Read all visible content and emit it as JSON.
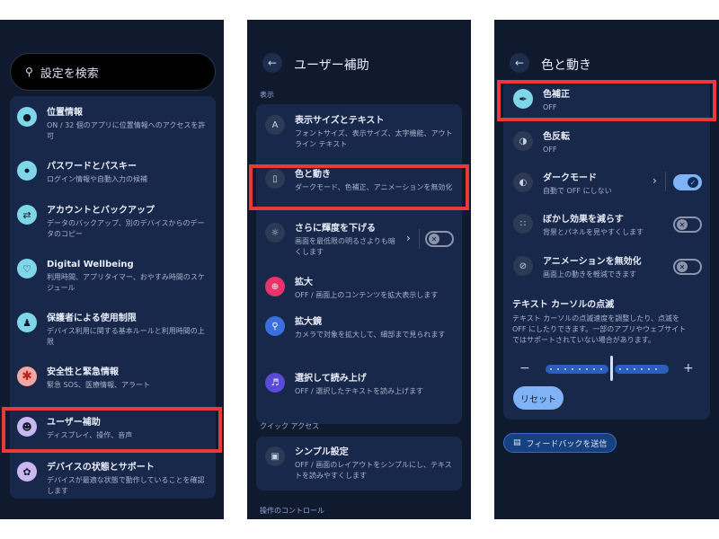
{
  "panel1": {
    "search_placeholder": "設定を検索",
    "items": [
      {
        "title": "位置情報",
        "sub": "ON / 32 個のアプリに位置情報へのアクセスを許可",
        "icon": "location-pin-icon",
        "color": "#7fd6e8"
      },
      {
        "title": "パスワードとパスキー",
        "sub": "ログイン情報や自動入力の候補",
        "icon": "key-icon",
        "color": "#7fd6e8"
      },
      {
        "title": "アカウントとバックアップ",
        "sub": "データのバックアップ、別のデバイスからのデータのコピー",
        "icon": "sync-icon",
        "color": "#7fd6e8"
      },
      {
        "title": "Digital Wellbeing",
        "sub": "利用時間、アプリタイマー、おやすみ時間のスケジュール",
        "icon": "wellbeing-icon",
        "color": "#7fd6e8"
      },
      {
        "title": "保護者による使用制限",
        "sub": "デバイス利用に関する基本ルールと利用時間の上限",
        "icon": "parental-icon",
        "color": "#7fd6e8"
      },
      {
        "title": "安全性と緊急情報",
        "sub": "緊急 SOS、医療情報、アラート",
        "icon": "asterisk-icon",
        "color": "#f4a6a0"
      },
      {
        "title": "ユーザー補助",
        "sub": "ディスプレイ、操作、音声",
        "icon": "accessibility-icon",
        "color": "#c9b7f0"
      },
      {
        "title": "デバイスの状態とサポート",
        "sub": "デバイスが最適な状態で動作していることを確認します",
        "icon": "device-health-icon",
        "color": "#c9b7f0"
      }
    ]
  },
  "panel2": {
    "header": "ユーザー補助",
    "section_display": "表示",
    "items": [
      {
        "title": "表示サイズとテキスト",
        "sub": "フォントサイズ、表示サイズ、太字機能、アウトライン テキスト"
      },
      {
        "title": "色と動き",
        "sub": "ダークモード、色補正、アニメーションを無効化"
      },
      {
        "title": "さらに輝度を下げる",
        "sub": "画面を最低限の明るさよりも暗くします"
      },
      {
        "title": "拡大",
        "sub": "OFF / 画面上のコンテンツを拡大表示します"
      },
      {
        "title": "拡大鏡",
        "sub": "カメラで対象を拡大して、細部まで見られます"
      },
      {
        "title": "選択して読み上げ",
        "sub": "OFF / 選択したテキストを読み上げます"
      }
    ],
    "section_quick": "クイック アクセス",
    "quick_item": {
      "title": "シンプル設定",
      "sub": "OFF / 画面のレイアウトをシンプルにし、テキストを読みやすくします"
    },
    "section_controls": "操作のコントロール"
  },
  "panel3": {
    "header": "色と動き",
    "items": [
      {
        "title": "色補正",
        "sub": "OFF"
      },
      {
        "title": "色反転",
        "sub": "OFF"
      },
      {
        "title": "ダークモード",
        "sub": "自動で OFF にしない"
      },
      {
        "title": "ぼかし効果を減らす",
        "sub": "背景とパネルを見やすくします"
      },
      {
        "title": "アニメーションを無効化",
        "sub": "画面上の動きを軽減できます"
      }
    ],
    "cursor": {
      "title": "テキスト カーソルの点滅",
      "desc": "テキスト カーソルの点滅速度を調整したり、点滅を OFF にしたりできます。一部のアプリやウェブサイトではサポートされていない場合があります。",
      "minus": "−",
      "plus": "+",
      "slider_value": 0.5
    },
    "reset_label": "リセット",
    "feedback_label": "フィードバックを送信",
    "dark_mode_on": true
  },
  "colors": {
    "highlight": "#e83a3a",
    "accent": "#7fb3f5",
    "panel_bg": "#0f1a2e",
    "card_bg": "#17284a"
  }
}
